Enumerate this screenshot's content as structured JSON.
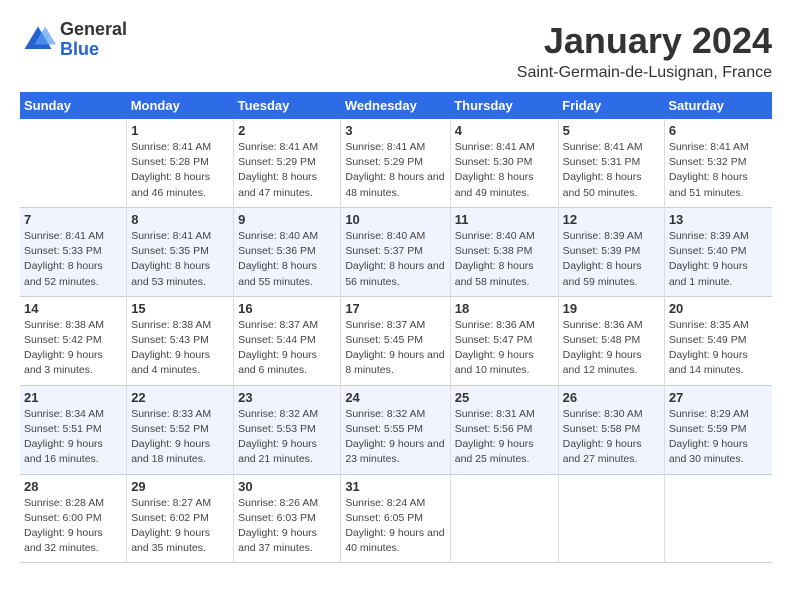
{
  "header": {
    "logo_general": "General",
    "logo_blue": "Blue",
    "month_title": "January 2024",
    "location": "Saint-Germain-de-Lusignan, France"
  },
  "days_header": [
    "Sunday",
    "Monday",
    "Tuesday",
    "Wednesday",
    "Thursday",
    "Friday",
    "Saturday"
  ],
  "weeks": [
    [
      {
        "num": "",
        "sunrise": "",
        "sunset": "",
        "daylight": ""
      },
      {
        "num": "1",
        "sunrise": "Sunrise: 8:41 AM",
        "sunset": "Sunset: 5:28 PM",
        "daylight": "Daylight: 8 hours and 46 minutes."
      },
      {
        "num": "2",
        "sunrise": "Sunrise: 8:41 AM",
        "sunset": "Sunset: 5:29 PM",
        "daylight": "Daylight: 8 hours and 47 minutes."
      },
      {
        "num": "3",
        "sunrise": "Sunrise: 8:41 AM",
        "sunset": "Sunset: 5:29 PM",
        "daylight": "Daylight: 8 hours and 48 minutes."
      },
      {
        "num": "4",
        "sunrise": "Sunrise: 8:41 AM",
        "sunset": "Sunset: 5:30 PM",
        "daylight": "Daylight: 8 hours and 49 minutes."
      },
      {
        "num": "5",
        "sunrise": "Sunrise: 8:41 AM",
        "sunset": "Sunset: 5:31 PM",
        "daylight": "Daylight: 8 hours and 50 minutes."
      },
      {
        "num": "6",
        "sunrise": "Sunrise: 8:41 AM",
        "sunset": "Sunset: 5:32 PM",
        "daylight": "Daylight: 8 hours and 51 minutes."
      }
    ],
    [
      {
        "num": "7",
        "sunrise": "Sunrise: 8:41 AM",
        "sunset": "Sunset: 5:33 PM",
        "daylight": "Daylight: 8 hours and 52 minutes."
      },
      {
        "num": "8",
        "sunrise": "Sunrise: 8:41 AM",
        "sunset": "Sunset: 5:35 PM",
        "daylight": "Daylight: 8 hours and 53 minutes."
      },
      {
        "num": "9",
        "sunrise": "Sunrise: 8:40 AM",
        "sunset": "Sunset: 5:36 PM",
        "daylight": "Daylight: 8 hours and 55 minutes."
      },
      {
        "num": "10",
        "sunrise": "Sunrise: 8:40 AM",
        "sunset": "Sunset: 5:37 PM",
        "daylight": "Daylight: 8 hours and 56 minutes."
      },
      {
        "num": "11",
        "sunrise": "Sunrise: 8:40 AM",
        "sunset": "Sunset: 5:38 PM",
        "daylight": "Daylight: 8 hours and 58 minutes."
      },
      {
        "num": "12",
        "sunrise": "Sunrise: 8:39 AM",
        "sunset": "Sunset: 5:39 PM",
        "daylight": "Daylight: 8 hours and 59 minutes."
      },
      {
        "num": "13",
        "sunrise": "Sunrise: 8:39 AM",
        "sunset": "Sunset: 5:40 PM",
        "daylight": "Daylight: 9 hours and 1 minute."
      }
    ],
    [
      {
        "num": "14",
        "sunrise": "Sunrise: 8:38 AM",
        "sunset": "Sunset: 5:42 PM",
        "daylight": "Daylight: 9 hours and 3 minutes."
      },
      {
        "num": "15",
        "sunrise": "Sunrise: 8:38 AM",
        "sunset": "Sunset: 5:43 PM",
        "daylight": "Daylight: 9 hours and 4 minutes."
      },
      {
        "num": "16",
        "sunrise": "Sunrise: 8:37 AM",
        "sunset": "Sunset: 5:44 PM",
        "daylight": "Daylight: 9 hours and 6 minutes."
      },
      {
        "num": "17",
        "sunrise": "Sunrise: 8:37 AM",
        "sunset": "Sunset: 5:45 PM",
        "daylight": "Daylight: 9 hours and 8 minutes."
      },
      {
        "num": "18",
        "sunrise": "Sunrise: 8:36 AM",
        "sunset": "Sunset: 5:47 PM",
        "daylight": "Daylight: 9 hours and 10 minutes."
      },
      {
        "num": "19",
        "sunrise": "Sunrise: 8:36 AM",
        "sunset": "Sunset: 5:48 PM",
        "daylight": "Daylight: 9 hours and 12 minutes."
      },
      {
        "num": "20",
        "sunrise": "Sunrise: 8:35 AM",
        "sunset": "Sunset: 5:49 PM",
        "daylight": "Daylight: 9 hours and 14 minutes."
      }
    ],
    [
      {
        "num": "21",
        "sunrise": "Sunrise: 8:34 AM",
        "sunset": "Sunset: 5:51 PM",
        "daylight": "Daylight: 9 hours and 16 minutes."
      },
      {
        "num": "22",
        "sunrise": "Sunrise: 8:33 AM",
        "sunset": "Sunset: 5:52 PM",
        "daylight": "Daylight: 9 hours and 18 minutes."
      },
      {
        "num": "23",
        "sunrise": "Sunrise: 8:32 AM",
        "sunset": "Sunset: 5:53 PM",
        "daylight": "Daylight: 9 hours and 21 minutes."
      },
      {
        "num": "24",
        "sunrise": "Sunrise: 8:32 AM",
        "sunset": "Sunset: 5:55 PM",
        "daylight": "Daylight: 9 hours and 23 minutes."
      },
      {
        "num": "25",
        "sunrise": "Sunrise: 8:31 AM",
        "sunset": "Sunset: 5:56 PM",
        "daylight": "Daylight: 9 hours and 25 minutes."
      },
      {
        "num": "26",
        "sunrise": "Sunrise: 8:30 AM",
        "sunset": "Sunset: 5:58 PM",
        "daylight": "Daylight: 9 hours and 27 minutes."
      },
      {
        "num": "27",
        "sunrise": "Sunrise: 8:29 AM",
        "sunset": "Sunset: 5:59 PM",
        "daylight": "Daylight: 9 hours and 30 minutes."
      }
    ],
    [
      {
        "num": "28",
        "sunrise": "Sunrise: 8:28 AM",
        "sunset": "Sunset: 6:00 PM",
        "daylight": "Daylight: 9 hours and 32 minutes."
      },
      {
        "num": "29",
        "sunrise": "Sunrise: 8:27 AM",
        "sunset": "Sunset: 6:02 PM",
        "daylight": "Daylight: 9 hours and 35 minutes."
      },
      {
        "num": "30",
        "sunrise": "Sunrise: 8:26 AM",
        "sunset": "Sunset: 6:03 PM",
        "daylight": "Daylight: 9 hours and 37 minutes."
      },
      {
        "num": "31",
        "sunrise": "Sunrise: 8:24 AM",
        "sunset": "Sunset: 6:05 PM",
        "daylight": "Daylight: 9 hours and 40 minutes."
      },
      {
        "num": "",
        "sunrise": "",
        "sunset": "",
        "daylight": ""
      },
      {
        "num": "",
        "sunrise": "",
        "sunset": "",
        "daylight": ""
      },
      {
        "num": "",
        "sunrise": "",
        "sunset": "",
        "daylight": ""
      }
    ]
  ]
}
